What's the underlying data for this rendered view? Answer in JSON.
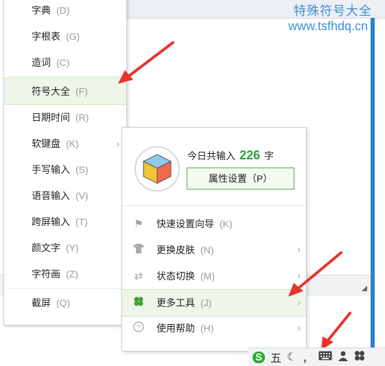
{
  "watermark": {
    "line1": "特殊符号大全",
    "line2": "www.tsfhdq.cn"
  },
  "left_menu": {
    "items": [
      {
        "label": "字典",
        "key": "(D)"
      },
      {
        "label": "字根表",
        "key": "(G)"
      },
      {
        "label": "造词",
        "key": "(C)"
      },
      {
        "label": "符号大全",
        "key": "(F)",
        "active": true
      },
      {
        "label": "日期时间",
        "key": "(R)"
      },
      {
        "label": "软键盘",
        "key": "(K)",
        "submenu": true
      },
      {
        "label": "手写输入",
        "key": "(S)"
      },
      {
        "label": "语音输入",
        "key": "(V)"
      },
      {
        "label": "跨屏输入",
        "key": "(T)"
      },
      {
        "label": "颜文字",
        "key": "(Y)"
      },
      {
        "label": "字符画",
        "key": "(Z)"
      },
      {
        "label": "截屏",
        "key": "(Q)"
      }
    ]
  },
  "right_menu": {
    "stat_prefix": "今日共输入",
    "stat_count": "226",
    "stat_suffix": "字",
    "prop_button": "属性设置（P）",
    "items": [
      {
        "icon": "flag-icon",
        "label": "快速设置向导",
        "key": "(K)"
      },
      {
        "icon": "shirt-icon",
        "label": "更换皮肤",
        "key": "(N)",
        "submenu": true
      },
      {
        "icon": "swap-icon",
        "label": "状态切换",
        "key": "(M)",
        "submenu": true
      },
      {
        "icon": "clover-icon",
        "label": "更多工具",
        "key": "(J)",
        "submenu": true,
        "active": true
      },
      {
        "icon": "help-icon",
        "label": "使用帮助",
        "key": "(H)",
        "submenu": true
      }
    ]
  },
  "taskbar": {
    "ime_mode": "五",
    "punct": "，"
  },
  "colors": {
    "accent_green": "#2e9c3c",
    "active_bg": "#eef6e9",
    "arrow_red": "#e8332a",
    "watermark_blue": "#3f8fd8"
  }
}
